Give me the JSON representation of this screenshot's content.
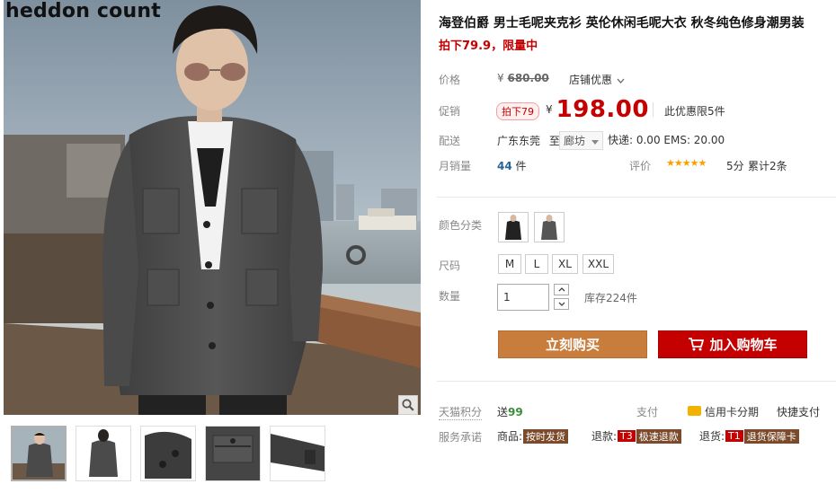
{
  "brand_overlay": "heddon count",
  "product": {
    "title": "海登伯爵 男士毛呢夹克衫 英伦休闲毛呢大衣 秋冬纯色修身潮男装",
    "subtitle": "拍下79.9，限量中"
  },
  "price": {
    "label": "价格",
    "currency": "¥",
    "original": "680.00",
    "shop_promo": "店铺优惠"
  },
  "promo": {
    "label": "促销",
    "tag": "拍下79",
    "currency": "¥",
    "price": "198.00",
    "limit": "此优惠限5件"
  },
  "shipping": {
    "label": "配送",
    "from": "广东东莞",
    "to_word": "至",
    "destination": "廊坊",
    "fee": "快递: 0.00 EMS: 20.00"
  },
  "sales": {
    "label": "月销量",
    "count": "44",
    "unit": "件",
    "rating_label": "评价",
    "stars": "★★★★★",
    "score": "5分",
    "reviews": "累计2条"
  },
  "options": {
    "color_label": "颜色分类",
    "size_label": "尺码",
    "sizes": [
      "M",
      "L",
      "XL",
      "XXL"
    ],
    "qty_label": "数量",
    "qty_value": "1",
    "stock": "库存224件"
  },
  "actions": {
    "buy_now": "立刻购买",
    "add_to_cart": "加入购物车"
  },
  "services": {
    "points_label": "天猫积分",
    "points_prefix": "送",
    "points_value": "99",
    "pay_label": "支付",
    "credit_card": "信用卡分期",
    "quick_pay": "快捷支付",
    "promise_label": "服务承诺",
    "goods_prefix": "商品:",
    "goods_tag": "按时发货",
    "refund_prefix": "退款:",
    "refund_code": "T3",
    "refund_tag": "极速退款",
    "return_prefix": "退货:",
    "return_code": "T1",
    "return_tag": "退货保障卡"
  },
  "colors": {
    "accent_red": "#c40000",
    "buy_orange": "#c87d3c",
    "star_gold": "#f5a200"
  },
  "icons": [
    "zoom-icon",
    "chevron-down-icon",
    "cart-icon",
    "credit-card-icon",
    "arrow-up-icon",
    "arrow-down-icon"
  ]
}
